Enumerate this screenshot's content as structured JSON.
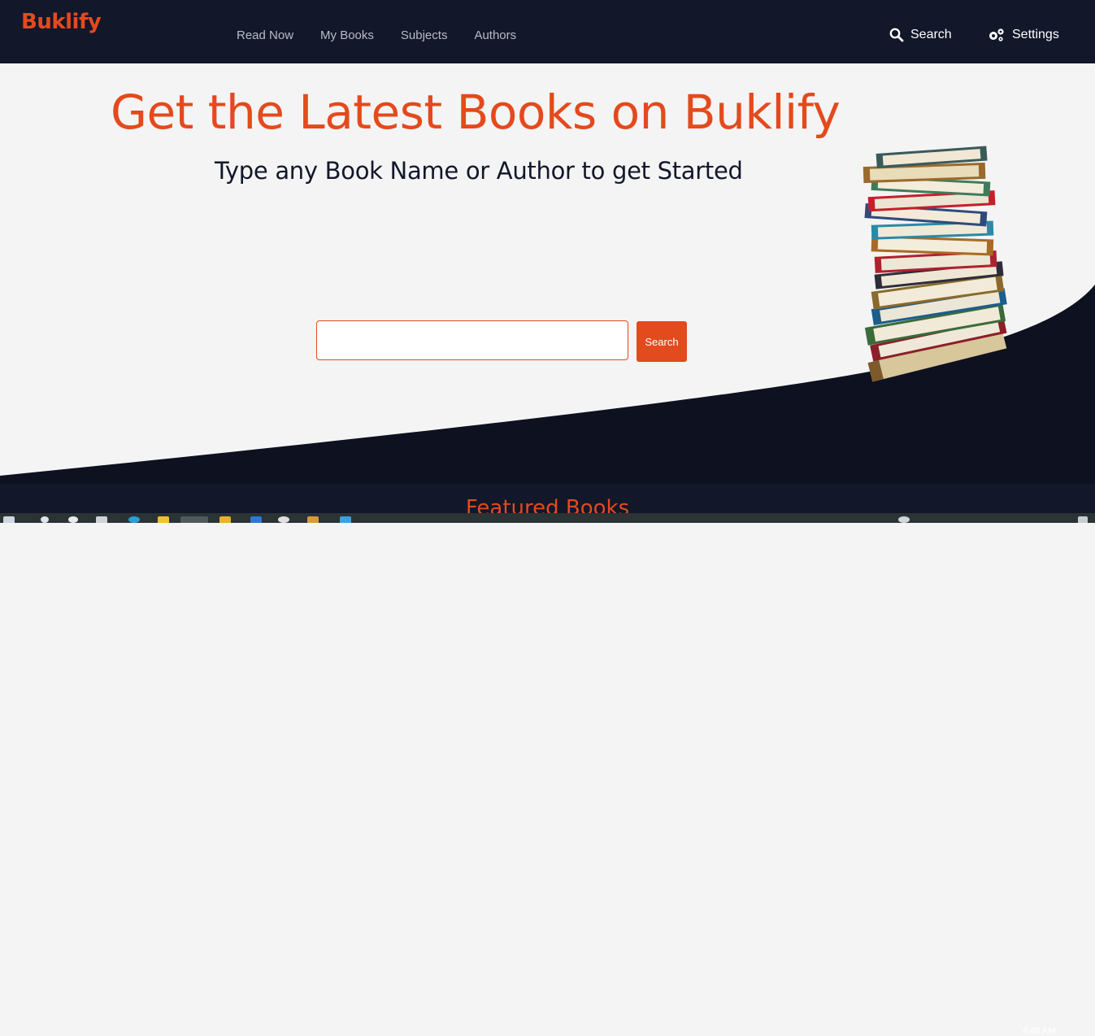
{
  "brand": "Buklify",
  "nav": {
    "links": [
      "Read Now",
      "My Books",
      "Subjects",
      "Authors"
    ],
    "search_label": "Search",
    "settings_label": "Settings"
  },
  "hero": {
    "title": "Get the Latest Books on Buklify",
    "subtitle": "Type any Book Name or Author to get Started",
    "search_value": "",
    "search_button_label": "Search"
  },
  "featured": {
    "title": "Featured Books"
  },
  "taskbar": {
    "clock": "4:48 AM"
  },
  "colors": {
    "accent": "#e34a1d",
    "navy": "#12172a",
    "hero_bg": "#f4f4f4"
  }
}
